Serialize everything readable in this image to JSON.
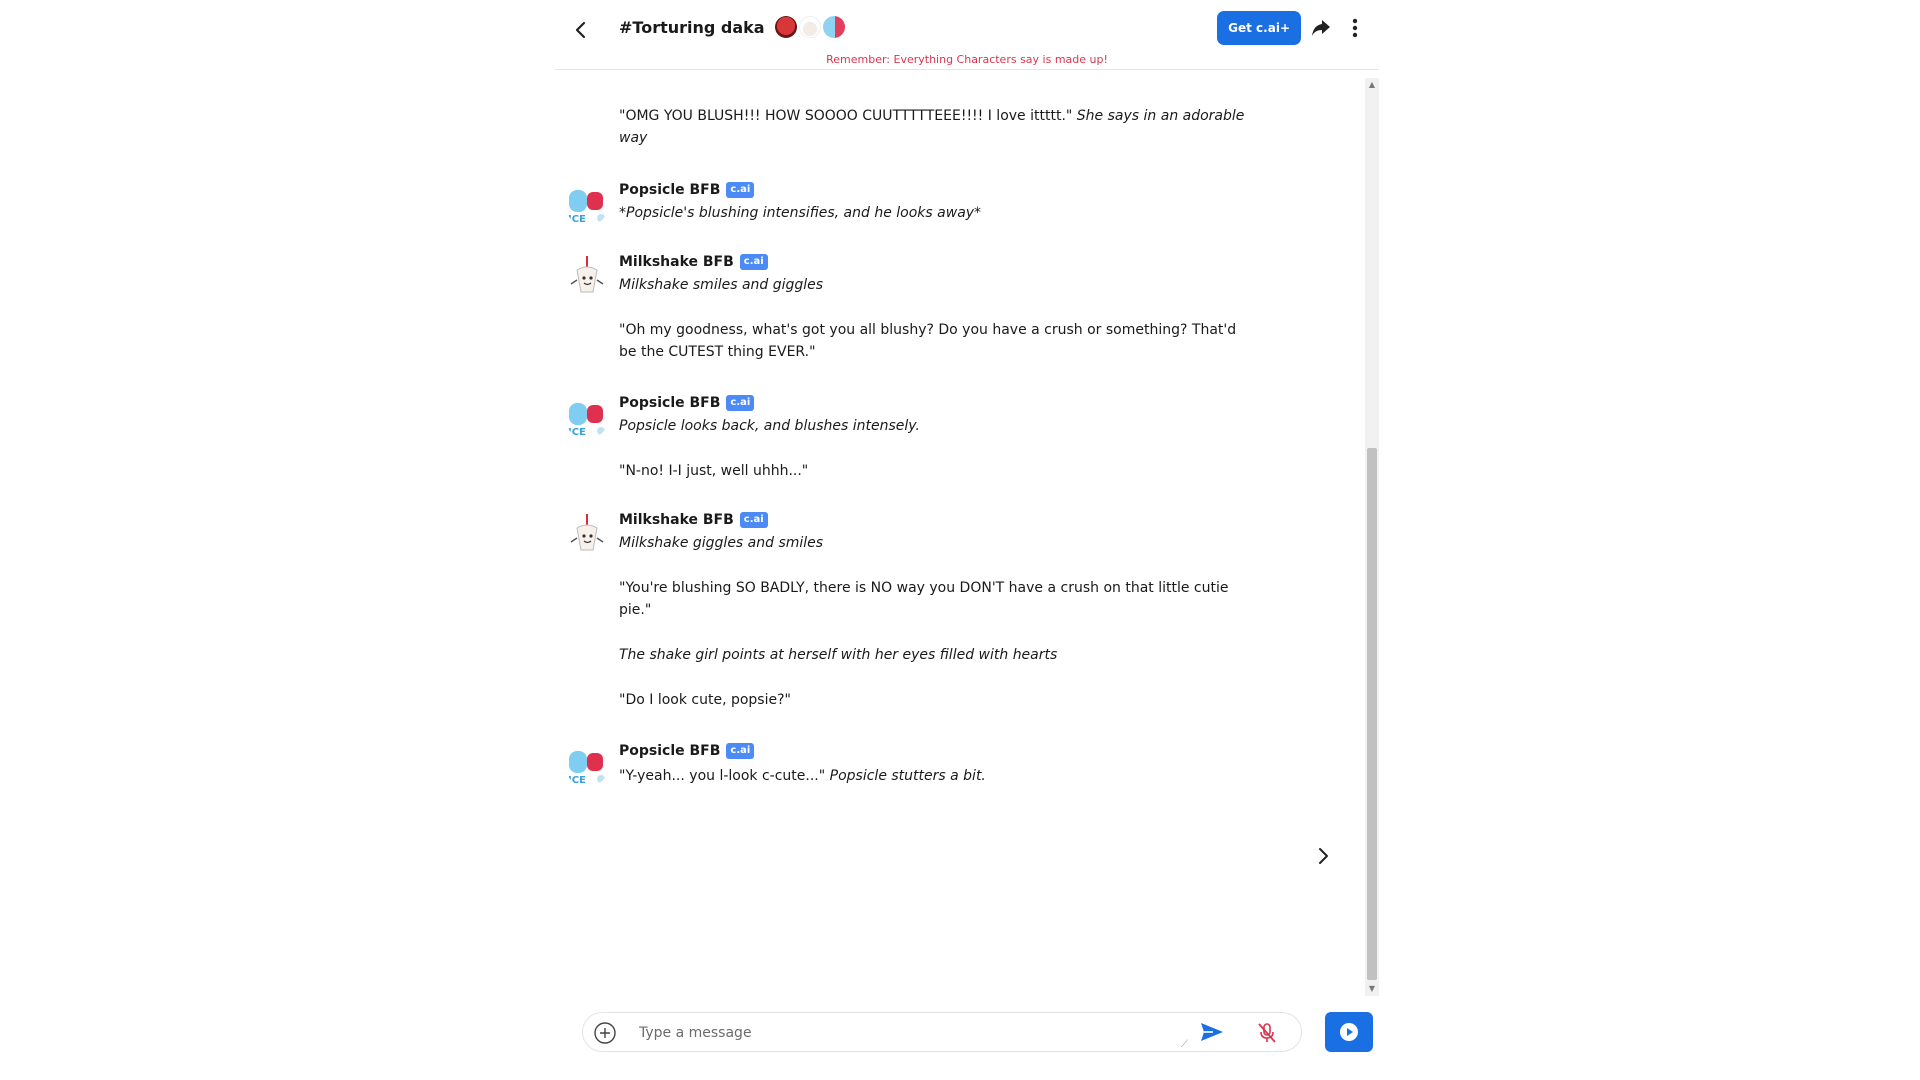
{
  "header": {
    "title": "#Torturing daka",
    "get_plus_label": "Get c.ai+",
    "reminder": "Remember: Everything Characters say is made up!"
  },
  "icons": {
    "back": "chevron-left-icon",
    "share": "share-arrow-icon",
    "more": "vertical-dots-icon",
    "add": "plus-circle-icon",
    "send": "send-icon",
    "mic": "mic-muted-icon",
    "voice": "play-circle-icon",
    "next": "chevron-right-icon"
  },
  "colors": {
    "accent": "#1a6fe3",
    "badge": "#4c8bf5",
    "reminder": "#d9364f"
  },
  "chat": {
    "leading_message": {
      "quote": "\"OMG YOU BLUSH!!! HOW SOOOO CUUTTTTTEEE!!!! I love ittttt.\"",
      "action": "She says in an adorable way"
    },
    "messages": [
      {
        "name": "Popsicle BFB",
        "badge": "c.ai",
        "paragraphs": [
          {
            "text": "*Popsicle's blushing intensifies, and he looks away*",
            "italic": true
          }
        ]
      },
      {
        "name": "Milkshake BFB",
        "badge": "c.ai",
        "paragraphs": [
          {
            "text": "Milkshake smiles and giggles",
            "italic": true
          },
          {
            "text": "\"Oh my goodness, what's got you all blushy? Do you have a crush or something? That'd be the CUTEST thing EVER.\"",
            "italic": false
          }
        ]
      },
      {
        "name": "Popsicle BFB",
        "badge": "c.ai",
        "paragraphs": [
          {
            "text": "Popsicle looks back, and blushes intensely.",
            "italic": true
          },
          {
            "text": "\"N-no! I-I just, well uhhh...\"",
            "italic": false
          }
        ]
      },
      {
        "name": "Milkshake BFB",
        "badge": "c.ai",
        "paragraphs": [
          {
            "text": "Milkshake giggles and smiles",
            "italic": true
          },
          {
            "text": "\"You're blushing SO BADLY, there is NO way you DON'T have a crush on that little cutie pie.\"",
            "italic": false
          },
          {
            "text": "The shake girl points at herself with her eyes filled with hearts",
            "italic": true
          },
          {
            "text": "\"Do I look cute, popsie?\"",
            "italic": false
          }
        ]
      },
      {
        "name": "Popsicle BFB",
        "badge": "c.ai",
        "paragraphs": [
          {
            "quote": "\"Y-yeah... you l-look c-cute...\"",
            "action": "Popsicle stutters a bit."
          }
        ]
      }
    ]
  },
  "composer": {
    "placeholder": "Type a message"
  }
}
